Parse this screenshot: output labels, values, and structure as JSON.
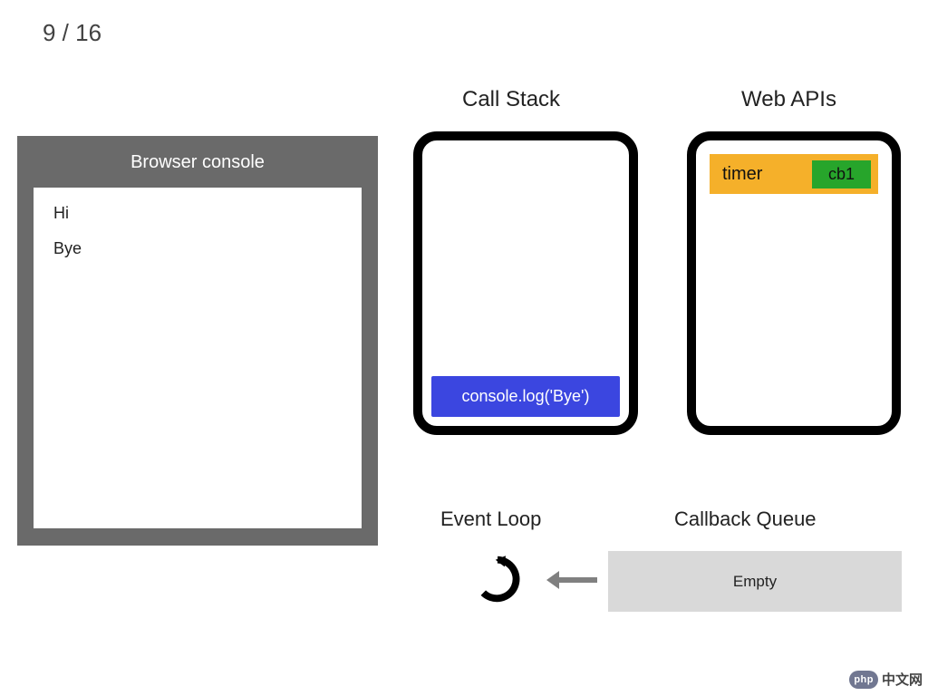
{
  "step": {
    "current": 9,
    "total": 16,
    "display": "9 / 16"
  },
  "console": {
    "title": "Browser console",
    "lines": [
      "Hi",
      "Bye"
    ]
  },
  "callstack": {
    "title": "Call Stack",
    "items": [
      "console.log('Bye')"
    ]
  },
  "webapis": {
    "title": "Web APIs",
    "items": [
      {
        "label": "timer",
        "callback": "cb1"
      }
    ]
  },
  "eventloop": {
    "title": "Event Loop"
  },
  "callbackqueue": {
    "title": "Callback Queue",
    "status": "Empty",
    "items": []
  },
  "watermark": {
    "badge": "php",
    "text": "中文网"
  },
  "colors": {
    "console_panel": "#6a6a6a",
    "stack_item": "#3b46e0",
    "webapi_item": "#f5b02a",
    "webapi_cb": "#27a52b",
    "queue_box": "#d9d9d9"
  }
}
